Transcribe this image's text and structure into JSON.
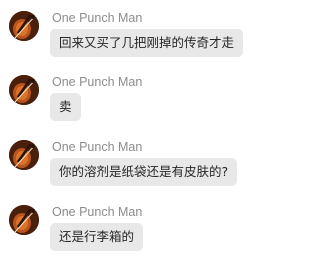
{
  "chat": {
    "messages": [
      {
        "sender": "One Punch Man",
        "text": "回来又买了几把刚掉的传奇才走",
        "avatar_icon": "violin-avatar-icon"
      },
      {
        "sender": "One Punch Man",
        "text": "卖",
        "avatar_icon": "violin-avatar-icon"
      },
      {
        "sender": "One Punch Man",
        "text": "你的溶剂是纸袋还是有皮肤的?",
        "avatar_icon": "violin-avatar-icon"
      },
      {
        "sender": "One Punch Man",
        "text": "还是行李箱的",
        "avatar_icon": "violin-avatar-icon"
      }
    ]
  },
  "colors": {
    "bubble_bg": "#e8e8e8",
    "sender_text": "#8c8c8c",
    "message_text": "#262626"
  }
}
